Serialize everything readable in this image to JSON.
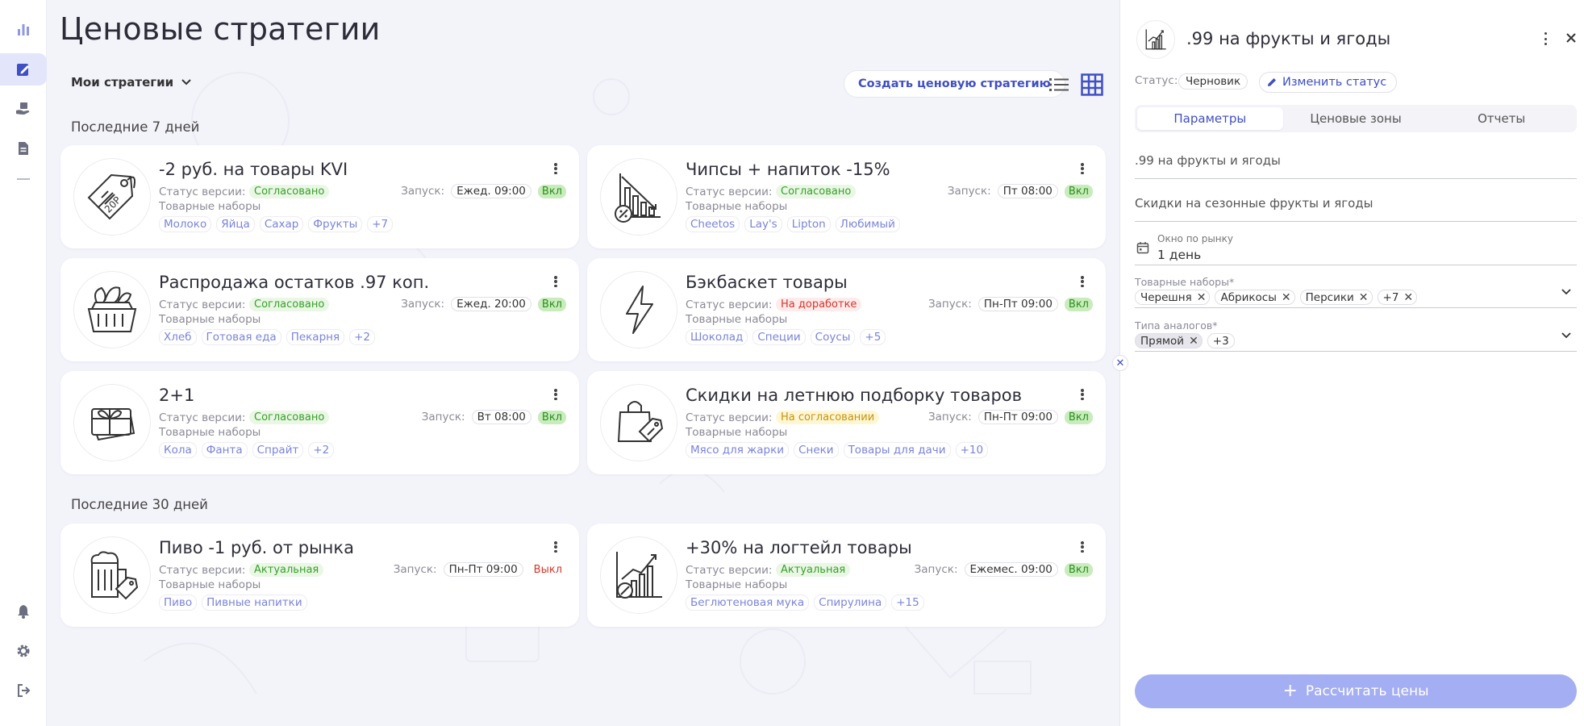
{
  "colors": {
    "accent": "#3f4fc4",
    "accent_light": "#a4aef2",
    "green": "#37a02a",
    "red": "#d7352c",
    "yellow": "#c8920c"
  },
  "sidebar": {
    "items": [
      {
        "icon": "bar-chart-icon",
        "active": false
      },
      {
        "icon": "edit-note-icon",
        "active": true
      },
      {
        "icon": "hand-box-icon",
        "active": false
      },
      {
        "icon": "document-icon",
        "active": false
      },
      {
        "icon": "bell-icon",
        "active": false
      },
      {
        "icon": "gear-icon",
        "active": false
      },
      {
        "icon": "logout-icon",
        "active": false
      }
    ]
  },
  "main": {
    "title": "Ценовые стратегии",
    "filter_label": "Мои стратегии",
    "create_button": "Создать ценовую стратегию",
    "sections": [
      {
        "title": "Последние 7 дней"
      },
      {
        "title": "Последние 30 дней"
      }
    ],
    "labels": {
      "version_status": "Статус версии:",
      "launch": "Запуск:",
      "product_sets": "Товарные наборы"
    },
    "cards": [
      {
        "title": "-2 руб. на товары KVI",
        "icon": "price-tag-icon",
        "status": "Согласовано",
        "status_color": "green",
        "launch": "Ежед. 09:00",
        "state": "Вкл",
        "tags": [
          "Молоко",
          "Яйца",
          "Сахар",
          "Фрукты",
          "+7"
        ]
      },
      {
        "title": "Чипсы + напиток -15%",
        "icon": "falling-chart-icon",
        "status": "Согласовано",
        "status_color": "green",
        "launch": "Пт 08:00",
        "state": "Вкл",
        "tags": [
          "Cheetos",
          "Lay's",
          "Lipton",
          "Любимый"
        ]
      },
      {
        "title": "Распродажа остатков .97 коп.",
        "icon": "basket-icon",
        "status": "Согласовано",
        "status_color": "green",
        "launch": "Ежед. 20:00",
        "state": "Вкл",
        "tags": [
          "Хлеб",
          "Готовая еда",
          "Пекарня",
          "+2"
        ]
      },
      {
        "title": "Бэкбаскет товары",
        "icon": "lightning-icon",
        "status": "На доработке",
        "status_color": "red",
        "launch": "Пн-Пт 09:00",
        "state": "Вкл",
        "tags": [
          "Шоколад",
          "Специи",
          "Соусы",
          "+5"
        ]
      },
      {
        "title": "2+1",
        "icon": "gift-cards-icon",
        "status": "Согласовано",
        "status_color": "green",
        "launch": "Вт 08:00",
        "state": "Вкл",
        "tags": [
          "Кола",
          "Фанта",
          "Спрайт",
          "+2"
        ]
      },
      {
        "title": "Скидки на летнюю подборку товаров",
        "icon": "shopping-bag-icon",
        "status": "На согласовании",
        "status_color": "yellow",
        "launch": "Пн-Пт 09:00",
        "state": "Вкл",
        "tags": [
          "Мясо для жарки",
          "Снеки",
          "Товары для дачи",
          "+10"
        ]
      },
      {
        "title": "Пиво -1 руб. от рынка",
        "icon": "beer-mug-icon",
        "status": "Актуальная",
        "status_color": "green",
        "launch": "Пн-Пт 09:00",
        "state": "Выкл",
        "tags": [
          "Пиво",
          "Пивные напитки"
        ]
      },
      {
        "title": "+30% на логтейл товары",
        "icon": "rising-chart-icon",
        "status": "Актуальная",
        "status_color": "green",
        "launch": "Ежемес. 09:00",
        "state": "Вкл",
        "tags": [
          "Беглютеновая мука",
          "Спирулина",
          "+15"
        ]
      }
    ]
  },
  "panel": {
    "icon": "rising-chart-icon",
    "title": ".99 на фрукты и ягоды",
    "status_label": "Статус:",
    "status": "Черновик",
    "change_status": "Изменить статус",
    "tabs": [
      {
        "label": "Параметры",
        "active": true
      },
      {
        "label": "Ценовые зоны",
        "active": false
      },
      {
        "label": "Отчеты",
        "active": false
      }
    ],
    "name_value": ".99 на фрукты и ягоды",
    "description_value": "Скидки на сезонные фрукты и ягоды",
    "window": {
      "label": "Окно по рынку",
      "value": "1 день"
    },
    "product_sets": {
      "label": "Товарные наборы",
      "required": "*",
      "chips": [
        "Черешня",
        "Абрикосы",
        "Персики",
        "+7"
      ]
    },
    "analog_types": {
      "label": "Типа аналогов",
      "required": "*",
      "chips": [
        "Прямой",
        "+3"
      ]
    },
    "calc_button": "Рассчитать цены",
    "calc_icon": "+"
  }
}
